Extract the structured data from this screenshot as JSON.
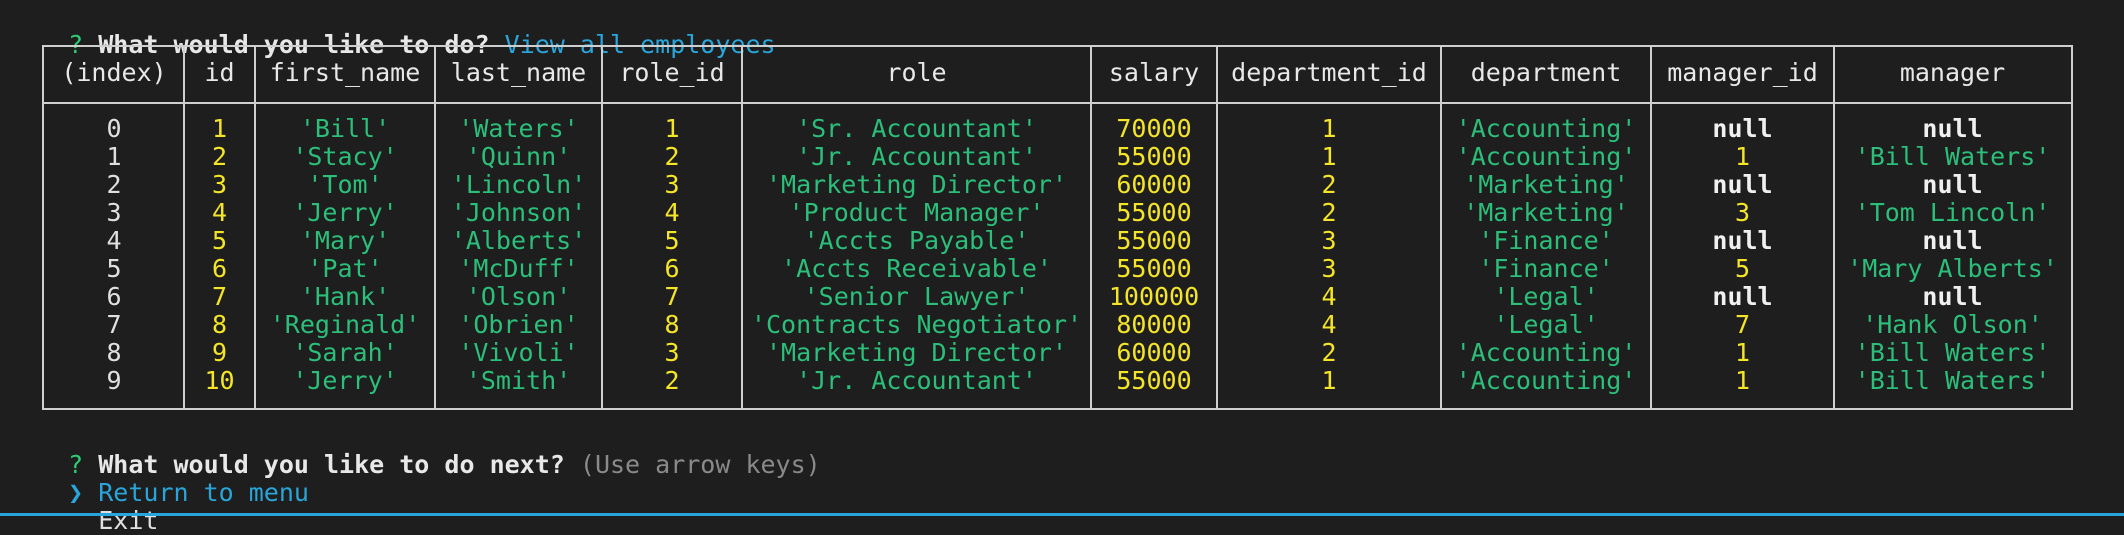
{
  "prompt1": {
    "mark": "?",
    "question": "What would you like to do?",
    "answer": "View all employees"
  },
  "table": {
    "headers": [
      "(index)",
      "id",
      "first_name",
      "last_name",
      "role_id",
      "role",
      "salary",
      "department_id",
      "department",
      "manager_id",
      "manager"
    ],
    "rows": [
      [
        "0",
        "1",
        "'Bill'",
        "'Waters'",
        "1",
        "'Sr. Accountant'",
        "70000",
        "1",
        "'Accounting'",
        "null",
        "null"
      ],
      [
        "1",
        "2",
        "'Stacy'",
        "'Quinn'",
        "2",
        "'Jr. Accountant'",
        "55000",
        "1",
        "'Accounting'",
        "1",
        "'Bill Waters'"
      ],
      [
        "2",
        "3",
        "'Tom'",
        "'Lincoln'",
        "3",
        "'Marketing Director'",
        "60000",
        "2",
        "'Marketing'",
        "null",
        "null"
      ],
      [
        "3",
        "4",
        "'Jerry'",
        "'Johnson'",
        "4",
        "'Product Manager'",
        "55000",
        "2",
        "'Marketing'",
        "3",
        "'Tom Lincoln'"
      ],
      [
        "4",
        "5",
        "'Mary'",
        "'Alberts'",
        "5",
        "'Accts Payable'",
        "55000",
        "3",
        "'Finance'",
        "null",
        "null"
      ],
      [
        "5",
        "6",
        "'Pat'",
        "'McDuff'",
        "6",
        "'Accts Receivable'",
        "55000",
        "3",
        "'Finance'",
        "5",
        "'Mary Alberts'"
      ],
      [
        "6",
        "7",
        "'Hank'",
        "'Olson'",
        "7",
        "'Senior Lawyer'",
        "100000",
        "4",
        "'Legal'",
        "null",
        "null"
      ],
      [
        "7",
        "8",
        "'Reginald'",
        "'Obrien'",
        "8",
        "'Contracts Negotiator'",
        "80000",
        "4",
        "'Legal'",
        "7",
        "'Hank Olson'"
      ],
      [
        "8",
        "9",
        "'Sarah'",
        "'Vivoli'",
        "3",
        "'Marketing Director'",
        "60000",
        "2",
        "'Accounting'",
        "1",
        "'Bill Waters'"
      ],
      [
        "9",
        "10",
        "'Jerry'",
        "'Smith'",
        "2",
        "'Jr. Accountant'",
        "55000",
        "1",
        "'Accounting'",
        "1",
        "'Bill Waters'"
      ]
    ]
  },
  "prompt2": {
    "mark": "?",
    "question": "What would you like to do next?",
    "hint": "(Use arrow keys)"
  },
  "menu": {
    "pointer": "❯",
    "options": [
      "Return to menu",
      "Exit"
    ]
  },
  "colors": {
    "background": "#1e1e1e",
    "string": "#2bbf7a",
    "number": "#f5e529",
    "accent": "#2aa5d9"
  }
}
